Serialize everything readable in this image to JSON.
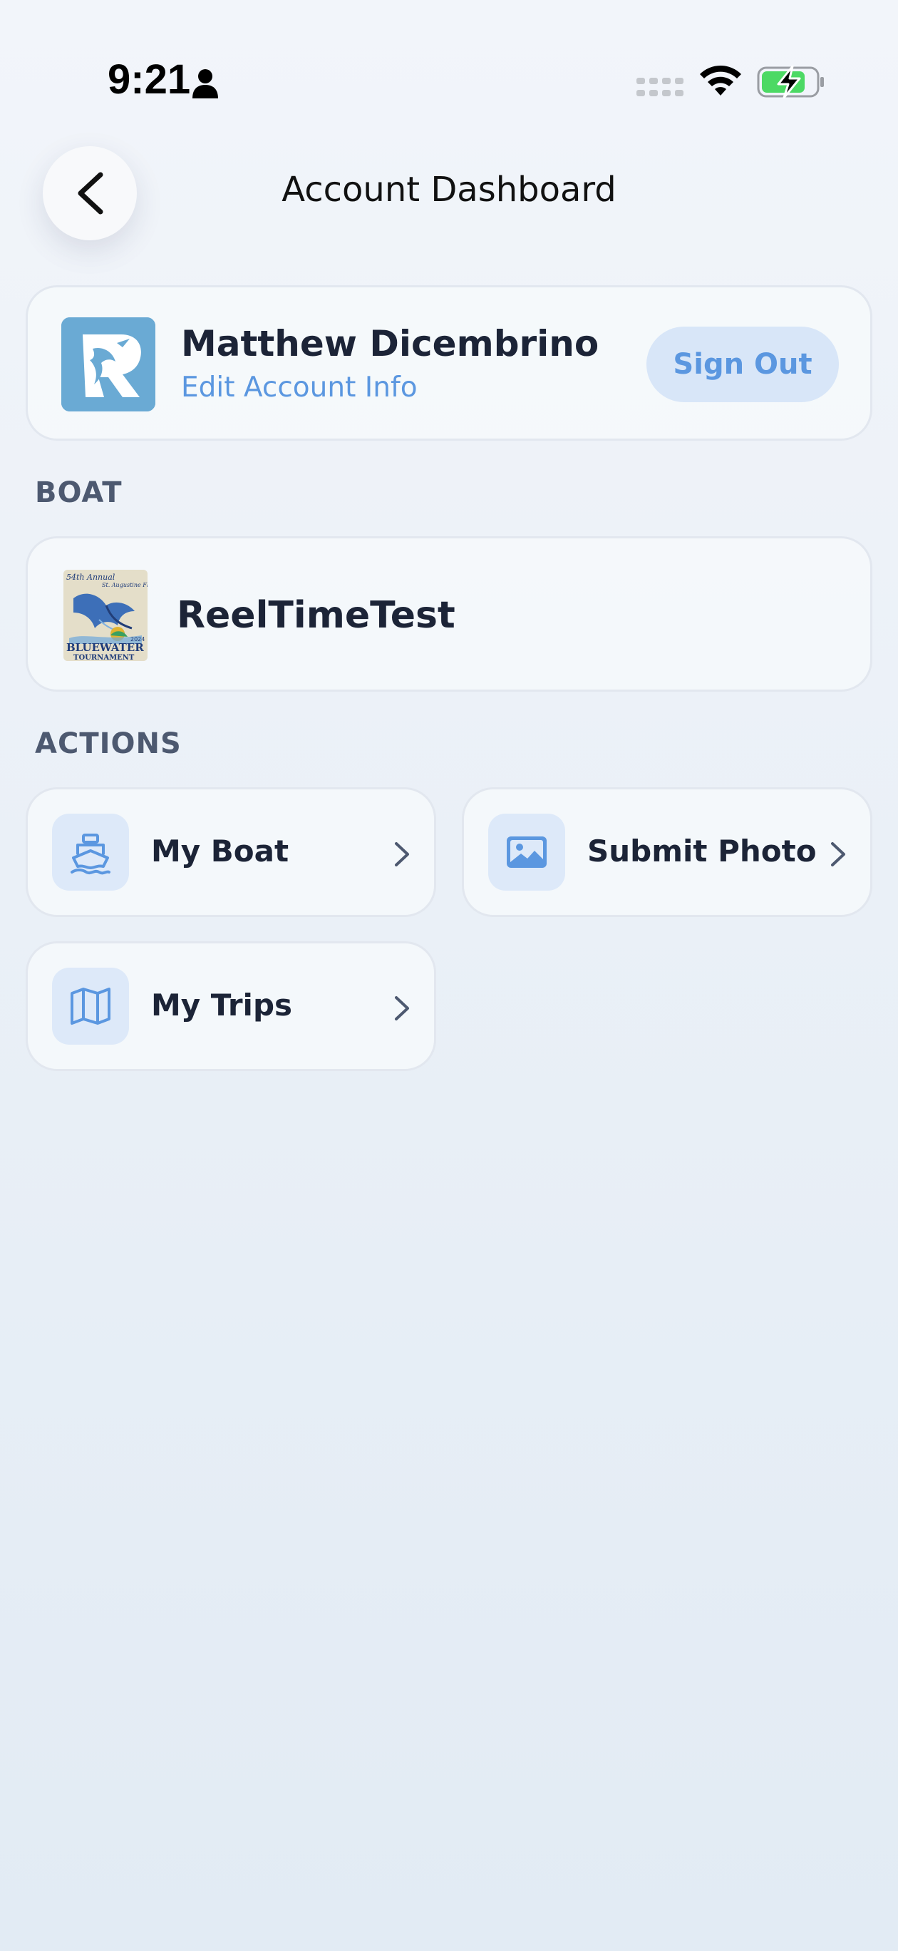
{
  "status_bar": {
    "time": "9:21",
    "icons": [
      "person-icon",
      "signal-icon",
      "wifi-icon",
      "battery-charging-icon"
    ]
  },
  "header": {
    "title": "Account Dashboard",
    "back_icon": "chevron-left-icon"
  },
  "account": {
    "name": "Matthew Dicembrino",
    "edit_link": "Edit Account Info",
    "sign_out_label": "Sign Out"
  },
  "boat_section": {
    "label": "BOAT",
    "boat_name": "ReelTimeTest",
    "logo_text": {
      "top": "54th Annual",
      "script": "St. Augustine Florida",
      "bottom": "BLUEWATER",
      "footer": "TOURNAMENT",
      "year": "2024"
    }
  },
  "actions_section": {
    "label": "ACTIONS",
    "items": [
      {
        "label": "My Boat",
        "icon": "boat-icon"
      },
      {
        "label": "Submit Photo",
        "icon": "image-icon"
      },
      {
        "label": "My Trips",
        "icon": "map-icon"
      }
    ]
  },
  "colors": {
    "accent": "#5b97e0",
    "accent_bg": "#d8e6f8",
    "text_primary": "#1c2437",
    "section_label": "#4d5970",
    "battery_green": "#4cd964",
    "avatar_bg": "#6aaad4"
  }
}
